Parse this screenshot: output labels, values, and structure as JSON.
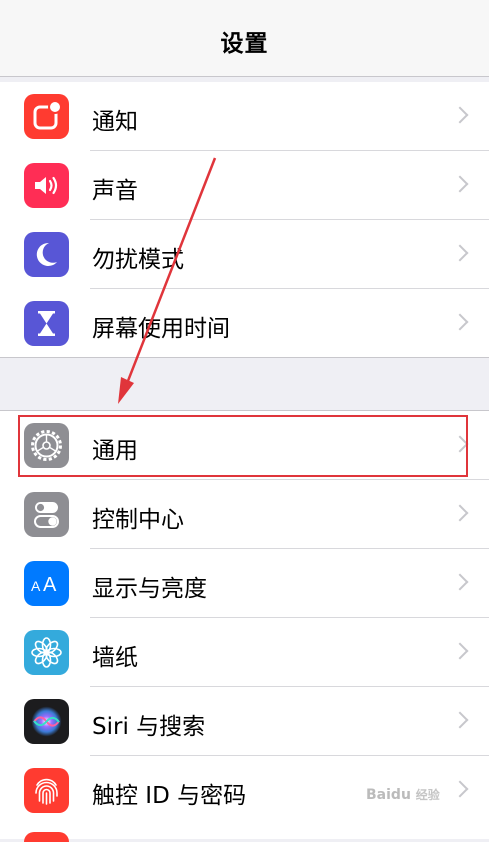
{
  "nav": {
    "title": "设置"
  },
  "groups": [
    {
      "items": [
        {
          "label": "通知",
          "icon": "notifications-icon",
          "color": "#ff3b30"
        },
        {
          "label": "声音",
          "icon": "sounds-icon",
          "color": "#ff2d55"
        },
        {
          "label": "勿扰模式",
          "icon": "do-not-disturb-icon",
          "color": "#5856d6"
        },
        {
          "label": "屏幕使用时间",
          "icon": "screen-time-icon",
          "color": "#5856d6"
        }
      ]
    },
    {
      "items": [
        {
          "label": "通用",
          "icon": "gear-icon",
          "color": "#8e8e93"
        },
        {
          "label": "控制中心",
          "icon": "control-center-icon",
          "color": "#8e8e93"
        },
        {
          "label": "显示与亮度",
          "icon": "display-brightness-icon",
          "color": "#007aff"
        },
        {
          "label": "墙纸",
          "icon": "wallpaper-icon",
          "color": "#34aadc"
        },
        {
          "label": "Siri 与搜索",
          "icon": "siri-icon",
          "color": "#1c1c1e"
        },
        {
          "label": "触控 ID 与密码",
          "icon": "touch-id-icon",
          "color": "#ff3b30"
        }
      ]
    }
  ],
  "annotation": {
    "highlight_color": "#e0353b"
  },
  "watermark": {
    "brand": "Baidu",
    "sub": "经验"
  }
}
